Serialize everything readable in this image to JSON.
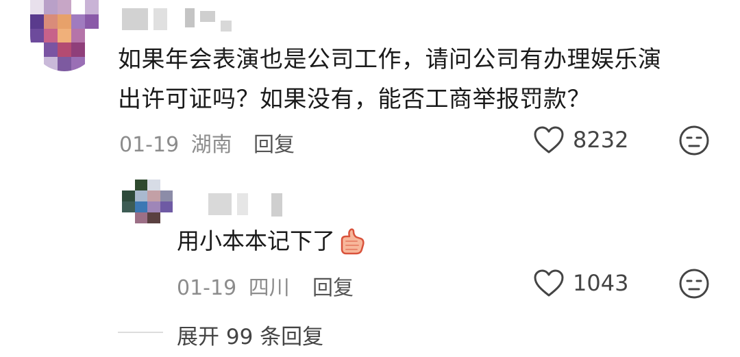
{
  "main_comment": {
    "avatar_colors": [
      "#e8e0ec",
      "#b9a0c8",
      "#c7a6c6",
      "#ffffff",
      "#c9b3d6",
      "#5a3b8d",
      "#d98c7a",
      "#e7a16a",
      "#a07bbf",
      "#8a5aa8",
      "#6d4b9c",
      "#c7628a",
      "#f0b07a",
      "#b574a9",
      "#ffffff",
      "#ffffff",
      "#7a54a2",
      "#b34b72",
      "#8f3f7a",
      "#ffffff",
      "#ffffff",
      "#c9b9d9",
      "#7d5aa0",
      "#9a6fb5",
      "#ffffff"
    ],
    "text_line1": "如果年会表演也是公司工作，请问公司有办理娱乐演",
    "text_line2": "出许可证吗？如果没有，能否工商举报罚款？",
    "date": "01-19",
    "location": "湖南",
    "reply_label": "回复",
    "like_count": "8232",
    "like_icon": "heart-outline",
    "emoji_icon": "neutral-face"
  },
  "reply_comment": {
    "avatar_colors": [
      "#ffffff",
      "#2f4a2f",
      "#d7dce6",
      "#ffffff",
      "#2d4a3b",
      "#a9b9cf",
      "#c3a0a6",
      "#8c8ca8",
      "#3d5c54",
      "#3c78b4",
      "#9f86b8",
      "#6e5aa4",
      "#ffffff",
      "#9c6f86",
      "#5a4040",
      "#ffffff"
    ],
    "text": "用小本本记下了",
    "text_emoji": "thumbs-up",
    "date": "01-19",
    "location": "四川",
    "reply_label": "回复",
    "like_count": "1043",
    "like_icon": "heart-outline",
    "emoji_icon": "neutral-face"
  },
  "expand_replies": "展开 99 条回复"
}
